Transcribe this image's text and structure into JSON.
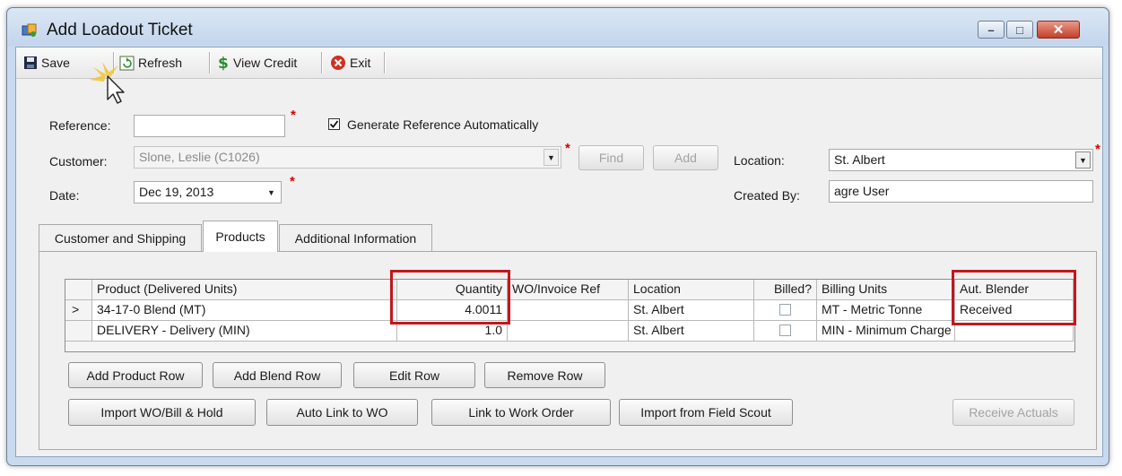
{
  "window": {
    "title": "Add Loadout Ticket",
    "min_glyph": "–",
    "max_glyph": "□",
    "close_glyph": "✕"
  },
  "toolbar": {
    "save_label": "Save",
    "refresh_label": "Refresh",
    "view_credit_label": "View Credit",
    "exit_label": "Exit"
  },
  "form": {
    "reference_label": "Reference:",
    "reference_value": "",
    "generate_reference_label": "Generate Reference Automatically",
    "generate_reference_checked": true,
    "customer_label": "Customer:",
    "customer_value": "Slone, Leslie (C1026)",
    "find_label": "Find",
    "add_label": "Add",
    "location_label": "Location:",
    "location_value": "St. Albert",
    "date_label": "Date:",
    "date_value": "Dec 19, 2013",
    "created_by_label": "Created By:",
    "created_by_value": "agre User",
    "required_mark": "*"
  },
  "tabs": [
    {
      "label": "Customer and Shipping",
      "active": false
    },
    {
      "label": "Products",
      "active": true
    },
    {
      "label": "Additional Information",
      "active": false
    }
  ],
  "grid": {
    "columns": [
      "Product (Delivered Units)",
      "Quantity",
      "WO/Invoice Ref",
      "Location",
      "Billed?",
      "Billing Units",
      "Aut. Blender"
    ],
    "rows": [
      {
        "indicator": ">",
        "product": "34-17-0 Blend (MT)",
        "quantity": "4.0011",
        "wo_ref": "",
        "location": "St. Albert",
        "billed": false,
        "billing_units": "MT - Metric Tonne",
        "aut_blender": "Received"
      },
      {
        "indicator": "",
        "product": "DELIVERY - Delivery (MIN)",
        "quantity": "1.0",
        "wo_ref": "",
        "location": "St. Albert",
        "billed": false,
        "billing_units": "MIN - Minimum Charge",
        "aut_blender": ""
      }
    ]
  },
  "actions": {
    "add_product_row": "Add Product Row",
    "add_blend_row": "Add Blend Row",
    "edit_row": "Edit Row",
    "remove_row": "Remove Row",
    "import_wo": "Import WO/Bill & Hold",
    "auto_link": "Auto Link to WO",
    "link_work_order": "Link to Work Order",
    "import_field_scout": "Import from Field Scout",
    "receive_actuals": "Receive Actuals"
  },
  "icons": {
    "app": "app-icon",
    "save": "floppy-disk-icon",
    "refresh": "refresh-icon",
    "view_credit": "dollar-icon",
    "exit": "red-x-icon",
    "cursor": "mouse-pointer-icon"
  },
  "colors": {
    "highlight": "#c4161c",
    "required": "#d40000"
  }
}
